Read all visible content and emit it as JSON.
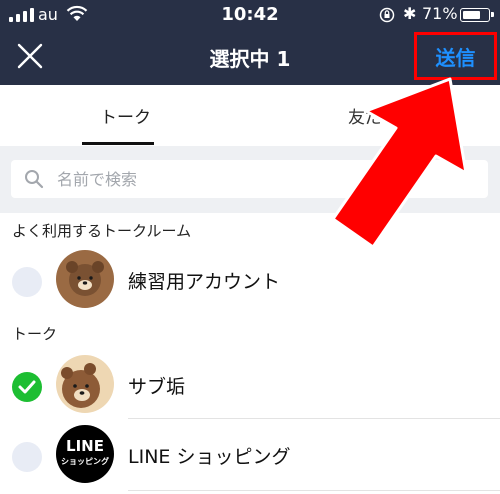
{
  "status_bar": {
    "carrier": "au",
    "time": "10:42",
    "battery_percent": "71%",
    "battery_level": 0.71,
    "bluetooth_glyph": "✱",
    "icons": [
      "signal-icon",
      "wifi-icon",
      "rotation-lock-icon",
      "bluetooth-icon",
      "battery-icon"
    ]
  },
  "nav": {
    "close_icon": "close-icon",
    "title": "選択中 1",
    "send_label": "送信"
  },
  "tabs": [
    {
      "label": "トーク",
      "active": true
    },
    {
      "label": "友だ"
    }
  ],
  "search": {
    "placeholder": "名前で検索",
    "icon": "search-icon"
  },
  "sections": {
    "frequent_title": "よく利用するトークルーム",
    "talk_title": "トーク"
  },
  "rows": [
    {
      "name": "練習用アカウント",
      "selected": false,
      "avatar": "brown-bear-avatar"
    },
    {
      "name": "サブ垢",
      "selected": true,
      "avatar": "brown-bear-avatar"
    },
    {
      "name": "LINE ショッピング",
      "selected": false,
      "avatar": "line-shopping-logo",
      "logo_line1": "LINE",
      "logo_line2": "ショッピング"
    }
  ],
  "colors": {
    "header_bg": "#283046",
    "send_text": "#1e90ff",
    "highlight_red": "#ff0000",
    "check_green": "#1dbe32",
    "search_bg": "#eef0f3"
  }
}
